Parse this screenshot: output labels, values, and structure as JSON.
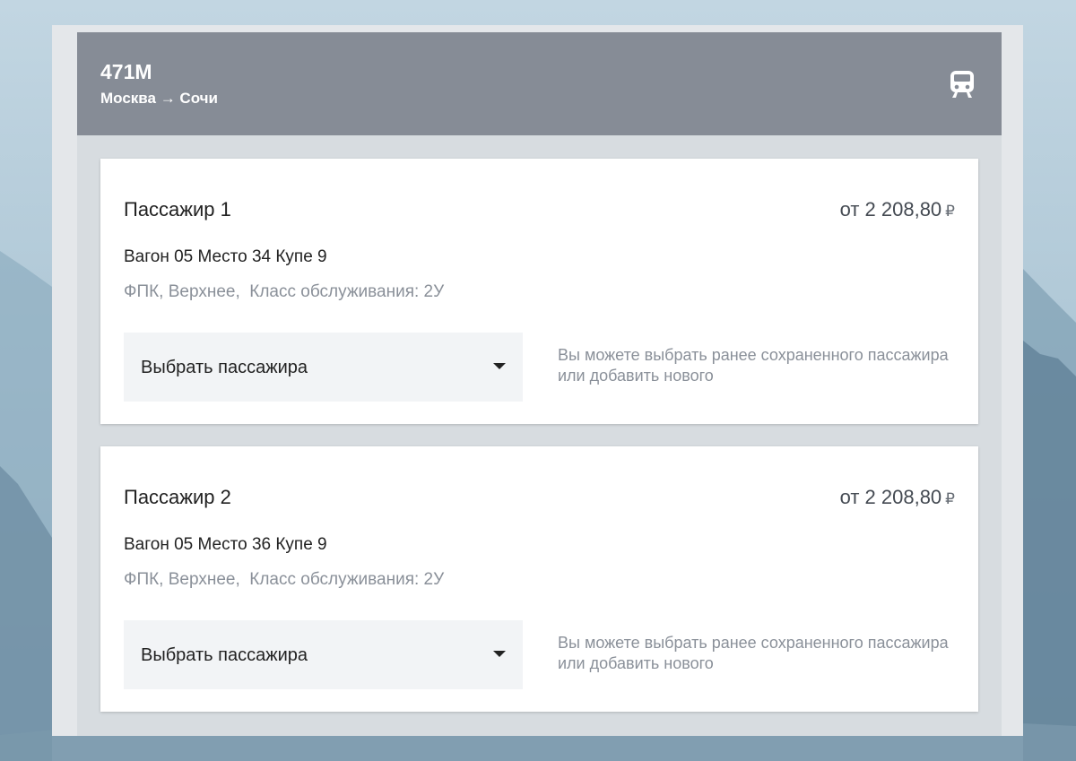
{
  "train": {
    "number": "471М",
    "route": "Москва → Сочи",
    "icon": "train-icon"
  },
  "passengers": [
    {
      "title": "Пассажир 1",
      "price": "от 2 208,80",
      "currency": "₽",
      "seat": "Вагон 05 Место 34 Купе 9",
      "service": "ФПК, Верхнее,  Класс обслуживания: 2У",
      "select_label": "Выбрать пассажира",
      "hint": "Вы можете выбрать ранее сохраненного пассажира или добавить нового"
    },
    {
      "title": "Пассажир 2",
      "price": "от 2 208,80",
      "currency": "₽",
      "seat": "Вагон 05 Место 36 Купе 9",
      "service": "ФПК, Верхнее,  Класс обслуживания: 2У",
      "select_label": "Выбрать пассажира",
      "hint": "Вы можете выбрать ранее сохраненного пассажира или добавить нового"
    }
  ],
  "colors": {
    "header_bg": "#868c96",
    "panel_bg": "#e4e7ea",
    "card_bg": "#ffffff",
    "select_bg": "#f2f4f6",
    "muted_text": "#8a9099"
  }
}
